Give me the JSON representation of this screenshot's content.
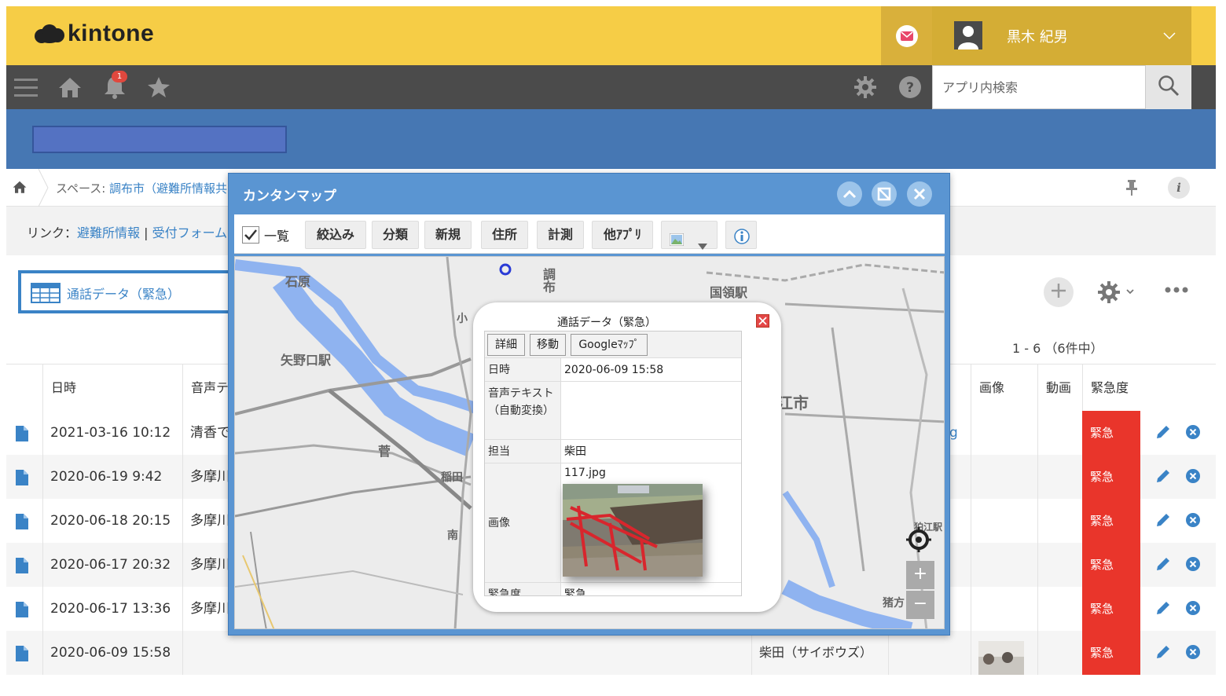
{
  "header": {
    "logo": "kintone",
    "user_name": "黒木 紀男"
  },
  "nav": {
    "notification_count": "1",
    "search_placeholder": "アプリ内検索"
  },
  "breadcrumb": {
    "prefix": "スペース: ",
    "space": "調布市（避難所情報共"
  },
  "links": {
    "label": "リンク：",
    "items": [
      "避難所情報",
      "受付フォーム"
    ],
    "sep": " | "
  },
  "view": {
    "name": "通話データ（緊急）"
  },
  "count": "1 - 6 （6件中）",
  "table": {
    "headers": {
      "datetime": "日時",
      "voice": "音声テ",
      "image": "画像",
      "video": "動画",
      "urgency": "緊急度"
    },
    "rows": [
      {
        "datetime": "2021-03-16 10:12",
        "voice": "清香で",
        "assignee": "",
        "link": "g",
        "urgency": "緊急"
      },
      {
        "datetime": "2020-06-19 9:42",
        "voice": "多摩川",
        "assignee": "",
        "link": "",
        "urgency": "緊急"
      },
      {
        "datetime": "2020-06-18 20:15",
        "voice": "多摩川",
        "assignee": "",
        "link": "",
        "urgency": "緊急"
      },
      {
        "datetime": "2020-06-17 20:32",
        "voice": "多摩川",
        "assignee": "",
        "link": "",
        "urgency": "緊急"
      },
      {
        "datetime": "2020-06-17 13:36",
        "voice": "多摩川",
        "assignee": "",
        "link": "",
        "urgency": "緊急"
      },
      {
        "datetime": "2020-06-09 15:58",
        "voice": "",
        "assignee": "柴田（サイボウズ）",
        "link": "",
        "urgency": "緊急"
      }
    ]
  },
  "map_dialog": {
    "title": "カンタンマップ",
    "toolbar": {
      "list_label": "一覧",
      "buttons": [
        "絞込み",
        "分類",
        "新規",
        "住所",
        "計測",
        "他ｱﾌﾟﾘ"
      ]
    },
    "map_labels": {
      "ishihara": "石原",
      "yaguchi": "矢野口駅",
      "kokuryo": "国領駅",
      "chofu": "調布",
      "komae": "江市",
      "inadazutsumi": "稲田",
      "suge": "菅",
      "minami": "南",
      "ko": "小",
      "inokata": "猪方",
      "komae_st": "狛江駅"
    },
    "popup": {
      "title": "通話データ（緊急）",
      "buttons": [
        "詳細",
        "移動",
        "Googleﾏｯﾌﾟ"
      ],
      "fields": [
        {
          "key": "日時",
          "value": "2020-06-09 15:58"
        },
        {
          "key": "音声テキスト（自動変換）",
          "value": ""
        },
        {
          "key": "担当",
          "value": "柴田"
        },
        {
          "key": "画像",
          "value": "117.jpg"
        },
        {
          "key": "緊急度",
          "value": "緊急"
        }
      ]
    }
  },
  "colors": {
    "header_yellow": "#f6cd46",
    "nav_dark": "#4b4b4b",
    "band_blue": "#4677b3",
    "dialog_blue": "#5a95d2",
    "urgent_red": "#e9352b",
    "link_blue": "#3a83c6"
  },
  "icons": [
    "menu-icon",
    "home-icon",
    "bell-icon",
    "star-icon",
    "gear-icon",
    "help-icon",
    "search-icon",
    "mail-icon",
    "pin-icon",
    "info-icon",
    "plus-icon",
    "more-icon",
    "document-icon",
    "edit-icon",
    "delete-icon",
    "collapse-icon",
    "restore-icon",
    "close-icon",
    "layer-icon",
    "locate-icon"
  ]
}
